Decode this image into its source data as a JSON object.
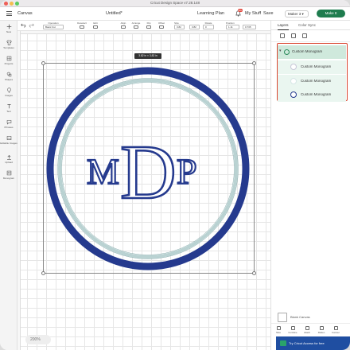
{
  "window": {
    "title": "Cricut Design Space  v7.28.148",
    "traffic_lights": [
      "#ee5f57",
      "#f4bd4f",
      "#5ccb5f"
    ]
  },
  "header": {
    "canvas_label": "Canvas",
    "project_name": "Untitled*",
    "learning_plan": "Learning Plan",
    "notifications_badge": "99+",
    "my_stuff": "My Stuff",
    "save": "Save",
    "machine": "Maker 3",
    "make_it": "Make It"
  },
  "toolbar": {
    "undo_icon": "undo-icon",
    "redo_icon": "redo-icon",
    "items": [
      {
        "label": "Operation"
      },
      {
        "label": "Deselect"
      },
      {
        "label": "Edit"
      },
      {
        "label": "Align"
      },
      {
        "label": "Arrange"
      },
      {
        "label": "Flip"
      },
      {
        "label": "Offset"
      },
      {
        "label": "Size"
      },
      {
        "label": "Rotate"
      },
      {
        "label": "Position"
      }
    ],
    "operation_value": "Basic Cut",
    "size_w": "3.82",
    "size_h": "3.82",
    "rotate_value": "0",
    "pos_x": "1.11",
    "pos_y": "0.735"
  },
  "sidebar": {
    "items": [
      {
        "label": "New",
        "icon": "plus-icon"
      },
      {
        "label": "Templates",
        "icon": "shirt-icon"
      },
      {
        "label": "Projects",
        "icon": "projects-icon"
      },
      {
        "label": "Shapes",
        "icon": "shapes-icon"
      },
      {
        "label": "Images",
        "icon": "lightbulb-icon"
      },
      {
        "label": "Text",
        "icon": "text-icon"
      },
      {
        "label": "Phrases",
        "icon": "phrases-icon"
      },
      {
        "label": "Editable Images",
        "icon": "editable-images-icon"
      },
      {
        "label": "Upload",
        "icon": "upload-icon"
      },
      {
        "label": "Monogram",
        "icon": "monogram-icon"
      }
    ]
  },
  "canvas": {
    "dimension_tip": "3.82 in × 3.82 in",
    "zoom": "200%",
    "monogram": {
      "left": "M",
      "center": "D",
      "right": "P",
      "outer_ring_color": "#253a8e",
      "inner_ring_color": "#b9d2d2"
    }
  },
  "panel": {
    "tabs": [
      "Layers",
      "Color Sync"
    ],
    "active_tab": 0,
    "layers": {
      "group_name": "Custom Monogram",
      "children": [
        {
          "name": "Custom Monogram",
          "thumb_color": "#2b3b8f"
        },
        {
          "name": "Custom Monogram",
          "thumb_color": "#c6dede"
        },
        {
          "name": "Custom Monogram",
          "thumb_color": "#253a8e"
        }
      ]
    },
    "blank_canvas_label": "Blank Canvas",
    "bottom_tools": [
      "Slice",
      "Combine",
      "Attach",
      "Flatten",
      "Contour"
    ],
    "access_banner": "Try Cricut Access for free"
  }
}
